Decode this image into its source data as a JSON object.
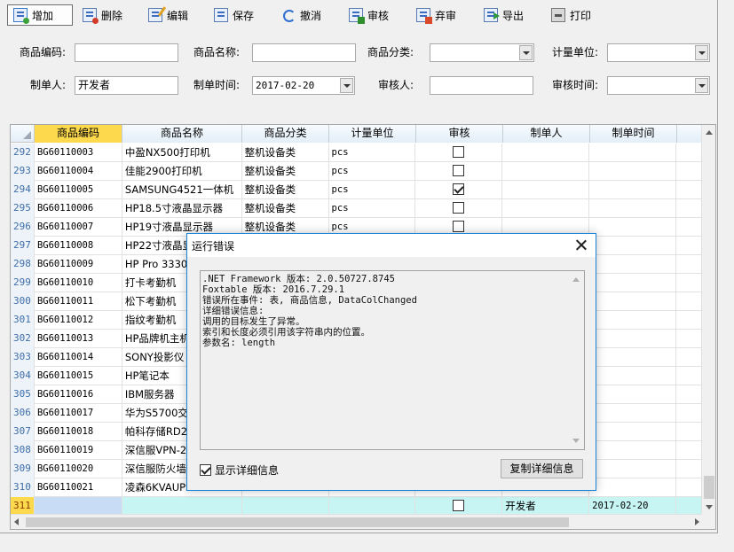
{
  "toolbar": {
    "buttons": [
      {
        "label": "增加",
        "icon": "add-record-icon"
      },
      {
        "label": "删除",
        "icon": "delete-record-icon"
      },
      {
        "label": "编辑",
        "icon": "edit-icon"
      },
      {
        "label": "保存",
        "icon": "save-icon"
      },
      {
        "label": "撤消",
        "icon": "undo-icon"
      },
      {
        "label": "审核",
        "icon": "audit-icon"
      },
      {
        "label": "弃审",
        "icon": "unaudit-icon"
      },
      {
        "label": "导出",
        "icon": "export-icon"
      },
      {
        "label": "打印",
        "icon": "print-icon"
      }
    ]
  },
  "form": {
    "product_code_label": "商品编码:",
    "product_code_value": "",
    "product_name_label": "商品名称:",
    "product_name_value": "",
    "category_label": "商品分类:",
    "category_value": "",
    "unit_label": "计量单位:",
    "unit_value": "",
    "creator_label": "制单人:",
    "creator_value": "开发者",
    "create_time_label": "制单时间:",
    "create_time_value": "2017-02-20",
    "auditor_label": "审核人:",
    "auditor_value": "",
    "audit_time_label": "审核时间:",
    "audit_time_value": ""
  },
  "grid": {
    "columns": [
      "商品编码",
      "商品名称",
      "商品分类",
      "计量单位",
      "审核",
      "制单人",
      "制单时间"
    ],
    "rows": [
      {
        "num": "292",
        "code": "BG60110003",
        "name": "中盈NX500打印机",
        "category": "整机设备类",
        "unit": "pcs",
        "audited": false,
        "creator": "",
        "time": ""
      },
      {
        "num": "293",
        "code": "BG60110004",
        "name": "佳能2900打印机",
        "category": "整机设备类",
        "unit": "pcs",
        "audited": false,
        "creator": "",
        "time": ""
      },
      {
        "num": "294",
        "code": "BG60110005",
        "name": "SAMSUNG4521一体机",
        "category": "整机设备类",
        "unit": "pcs",
        "audited": true,
        "creator": "",
        "time": ""
      },
      {
        "num": "295",
        "code": "BG60110006",
        "name": "HP18.5寸液晶显示器",
        "category": "整机设备类",
        "unit": "pcs",
        "audited": false,
        "creator": "",
        "time": ""
      },
      {
        "num": "296",
        "code": "BG60110007",
        "name": "HP19寸液晶显示器",
        "category": "整机设备类",
        "unit": "pcs",
        "audited": false,
        "creator": "",
        "time": ""
      },
      {
        "num": "297",
        "code": "BG60110008",
        "name": "HP22寸液晶显",
        "category": "",
        "unit": "",
        "audited": null,
        "creator": "",
        "time": ""
      },
      {
        "num": "298",
        "code": "BG60110009",
        "name": "HP Pro 3330",
        "category": "",
        "unit": "",
        "audited": null,
        "creator": "",
        "time": ""
      },
      {
        "num": "299",
        "code": "BG60110010",
        "name": "打卡考勤机",
        "category": "",
        "unit": "",
        "audited": null,
        "creator": "",
        "time": ""
      },
      {
        "num": "300",
        "code": "BG60110011",
        "name": "松下考勤机",
        "category": "",
        "unit": "",
        "audited": null,
        "creator": "",
        "time": ""
      },
      {
        "num": "301",
        "code": "BG60110012",
        "name": "指纹考勤机",
        "category": "",
        "unit": "",
        "audited": null,
        "creator": "",
        "time": ""
      },
      {
        "num": "302",
        "code": "BG60110013",
        "name": "HP品牌机主机",
        "category": "",
        "unit": "",
        "audited": null,
        "creator": "",
        "time": ""
      },
      {
        "num": "303",
        "code": "BG60110014",
        "name": "SONY投影仪",
        "category": "",
        "unit": "",
        "audited": null,
        "creator": "",
        "time": ""
      },
      {
        "num": "304",
        "code": "BG60110015",
        "name": "HP笔记本",
        "category": "",
        "unit": "",
        "audited": null,
        "creator": "",
        "time": ""
      },
      {
        "num": "305",
        "code": "BG60110016",
        "name": "IBM服务器",
        "category": "",
        "unit": "",
        "audited": null,
        "creator": "",
        "time": ""
      },
      {
        "num": "306",
        "code": "BG60110017",
        "name": "华为S5700交",
        "category": "",
        "unit": "",
        "audited": null,
        "creator": "",
        "time": ""
      },
      {
        "num": "307",
        "code": "BG60110018",
        "name": "帕科存储RD2",
        "category": "",
        "unit": "",
        "audited": null,
        "creator": "",
        "time": ""
      },
      {
        "num": "308",
        "code": "BG60110019",
        "name": "深信服VPN-20",
        "category": "",
        "unit": "",
        "audited": null,
        "creator": "",
        "time": ""
      },
      {
        "num": "309",
        "code": "BG60110020",
        "name": "深信服防火墙",
        "category": "",
        "unit": "",
        "audited": null,
        "creator": "",
        "time": ""
      },
      {
        "num": "310",
        "code": "BG60110021",
        "name": "凌森6KVAUPS",
        "category": "",
        "unit": "",
        "audited": null,
        "creator": "",
        "time": ""
      },
      {
        "num": "311",
        "code": "",
        "name": "",
        "category": "",
        "unit": "",
        "audited": false,
        "creator": "开发者",
        "time": "2017-02-20",
        "is_new": true
      }
    ]
  },
  "dialog": {
    "title": "运行错误",
    "lines": [
      ".NET Framework 版本: 2.0.50727.8745",
      "Foxtable 版本: 2016.7.29.1",
      "错误所在事件: 表, 商品信息, DataColChanged",
      "详细错误信息:",
      "调用的目标发生了异常。",
      "索引和长度必须引用该字符串内的位置。",
      "参数名: length"
    ],
    "show_detail_label": "显示详细信息",
    "show_detail_checked": true,
    "copy_button_label": "复制详细信息"
  },
  "colors": {
    "header_selected": "#fdd94d",
    "new_row": "#c6f5f3",
    "dialog_border": "#1883d7"
  }
}
